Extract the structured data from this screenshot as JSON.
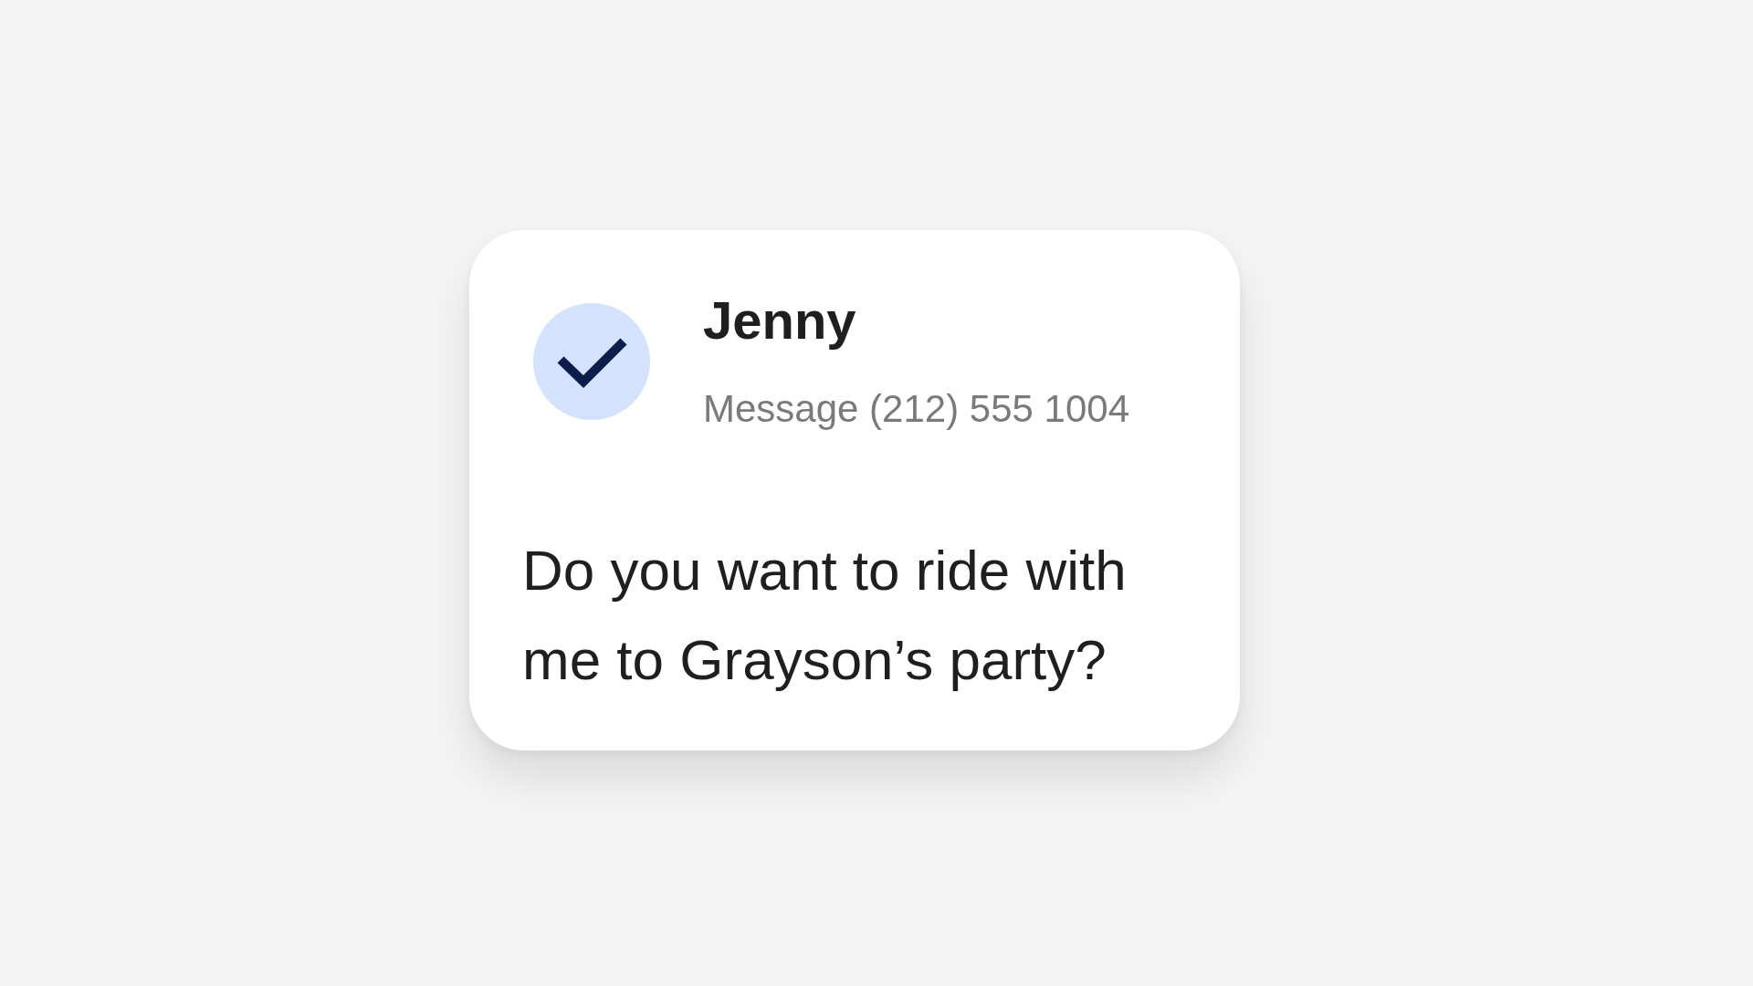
{
  "notification": {
    "contact": {
      "name": "Jenny",
      "subtitle": "Message (212) 555 1004",
      "selected": true
    },
    "message": "Do you want to ride with me to Grayson’s party?"
  }
}
